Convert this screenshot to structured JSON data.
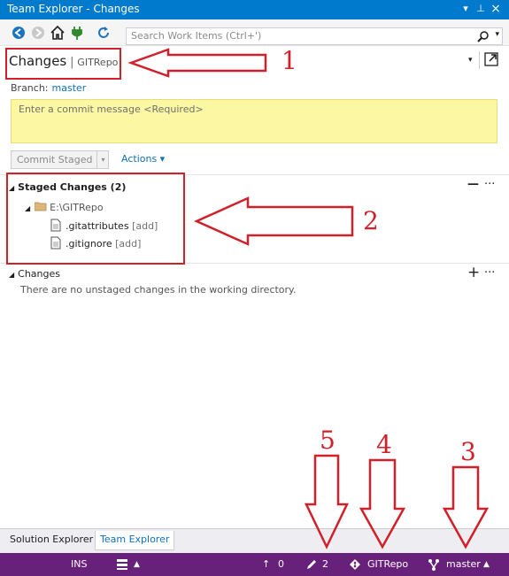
{
  "window": {
    "title": "Team Explorer - Changes",
    "dropdown_glyph": "▾",
    "pin_glyph": "⊥",
    "close_glyph": "×"
  },
  "toolbar": {
    "icons": [
      "back-icon",
      "forward-icon",
      "home-icon",
      "connect-icon",
      "refresh-icon"
    ],
    "search_placeholder": "Search Work Items (Ctrl+')"
  },
  "header": {
    "title": "Changes",
    "separator": "|",
    "repo": "GITRepo"
  },
  "branch": {
    "label": "Branch:",
    "value": "master"
  },
  "commit": {
    "placeholder": "Enter a commit message <Required>",
    "button": "Commit Staged",
    "actions": "Actions ▾"
  },
  "staged": {
    "title": "Staged Changes (2)",
    "folder": "E:\\GITRepo",
    "files": [
      {
        "name": ".gitattributes",
        "status": "[add]"
      },
      {
        "name": ".gitignore",
        "status": "[add]"
      }
    ],
    "collapse_glyph": "—",
    "more_glyph": "···"
  },
  "changes": {
    "title": "Changes",
    "empty_message": "There are no unstaged changes in the working directory.",
    "add_glyph": "+",
    "more_glyph": "···"
  },
  "bottom_tabs": [
    {
      "label": "Solution Explorer",
      "active": false
    },
    {
      "label": "Team Explorer",
      "active": true
    }
  ],
  "statusbar": {
    "mode": "INS",
    "unpushed_commits": "0",
    "pending_changes": "2",
    "repository": "GITRepo",
    "branch": "master",
    "up_glyph": "▲",
    "arrow_up": "↑"
  },
  "annotations": [
    "1",
    "2",
    "3",
    "4",
    "5"
  ],
  "colors": {
    "accent": "#007acc",
    "status_bar": "#68217a",
    "annotation": "#d0202a",
    "commit_box": "#fbf7a3",
    "link": "#0e70c0"
  }
}
